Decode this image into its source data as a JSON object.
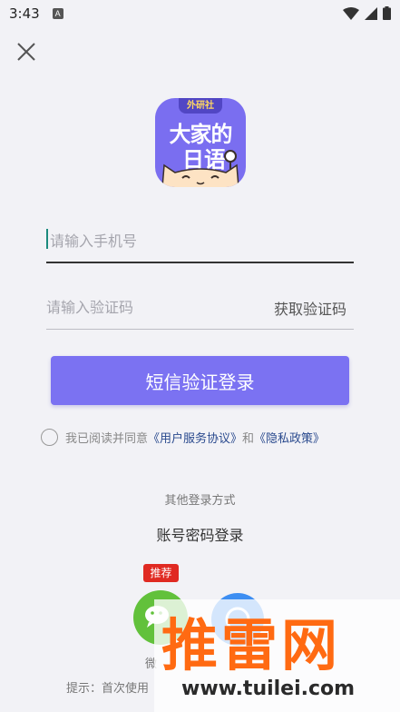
{
  "status_bar": {
    "time": "3:43",
    "notif_icon": "A"
  },
  "logo": {
    "tag": "外研社",
    "line1": "大家的",
    "line2": "日语"
  },
  "phone_field": {
    "placeholder": "请输入手机号"
  },
  "code_field": {
    "placeholder": "请输入验证码",
    "get_code_label": "获取验证码"
  },
  "login_button": {
    "label": "短信验证登录"
  },
  "agreement": {
    "prefix": "我已阅读并同意",
    "user_agreement": "《用户服务协议》",
    "and": "和",
    "privacy_policy": "《隐私政策》"
  },
  "other_login": {
    "title": "其他登录方式",
    "account_login": "账号密码登录",
    "recommend_badge": "推荐",
    "wechat_label": "微",
    "tip": "提示：首次使用"
  },
  "watermark": {
    "big": "推雷网",
    "url": "www.tuilei.com"
  },
  "colors": {
    "accent": "#7b72f2",
    "link": "#2a4a8e",
    "wechat": "#62c13b",
    "badge": "#e02a22"
  }
}
